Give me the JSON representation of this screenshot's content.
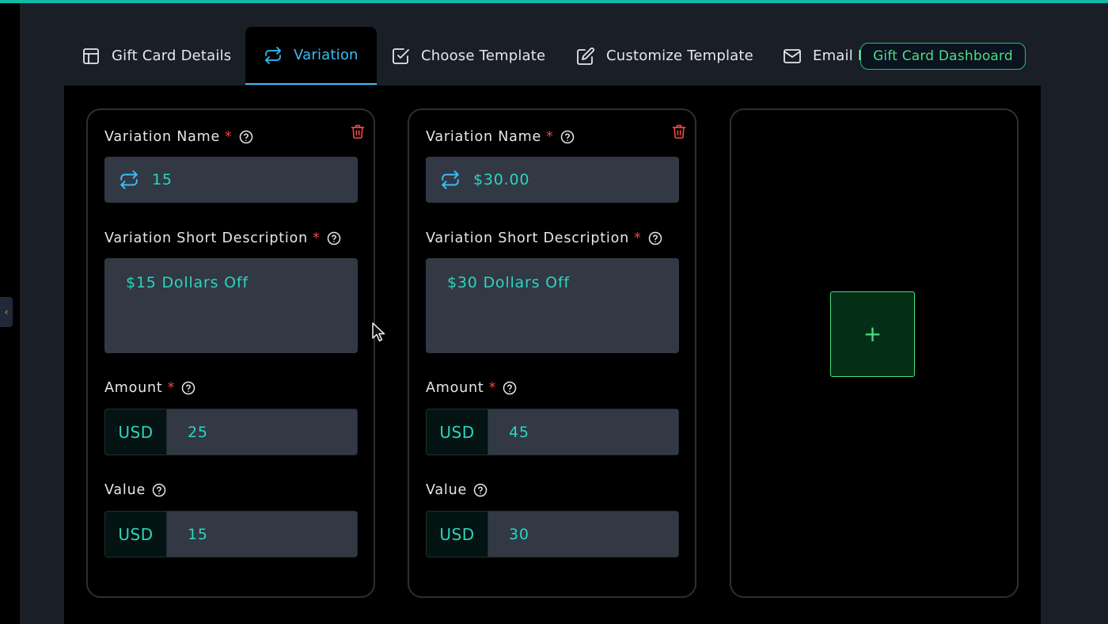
{
  "tabs": [
    {
      "label": "Gift Card Details",
      "icon": "layout-icon"
    },
    {
      "label": "Variation",
      "icon": "repeat-icon",
      "active": true
    },
    {
      "label": "Choose Template",
      "icon": "checkbox-icon"
    },
    {
      "label": "Customize Template",
      "icon": "edit-icon"
    },
    {
      "label": "Email N",
      "icon": "mail-icon"
    }
  ],
  "dashboard_button": "Gift Card Dashboard",
  "labels": {
    "variation_name": "Variation Name",
    "short_description": "Variation Short Description",
    "amount": "Amount",
    "value": "Value",
    "required_mark": "*"
  },
  "variations": [
    {
      "name": "15",
      "description": "$15 Dollars Off",
      "amount_currency": "USD",
      "amount": "25",
      "value_currency": "USD",
      "value": "15"
    },
    {
      "name": "$30.00",
      "description": "$30 Dollars Off",
      "amount_currency": "USD",
      "amount": "45",
      "value_currency": "USD",
      "value": "30"
    }
  ],
  "add_button": "+",
  "colors": {
    "accent_blue": "#38bdf8",
    "accent_teal": "#2dd4bf",
    "accent_green": "#4ade80",
    "danger": "#ef4444"
  }
}
